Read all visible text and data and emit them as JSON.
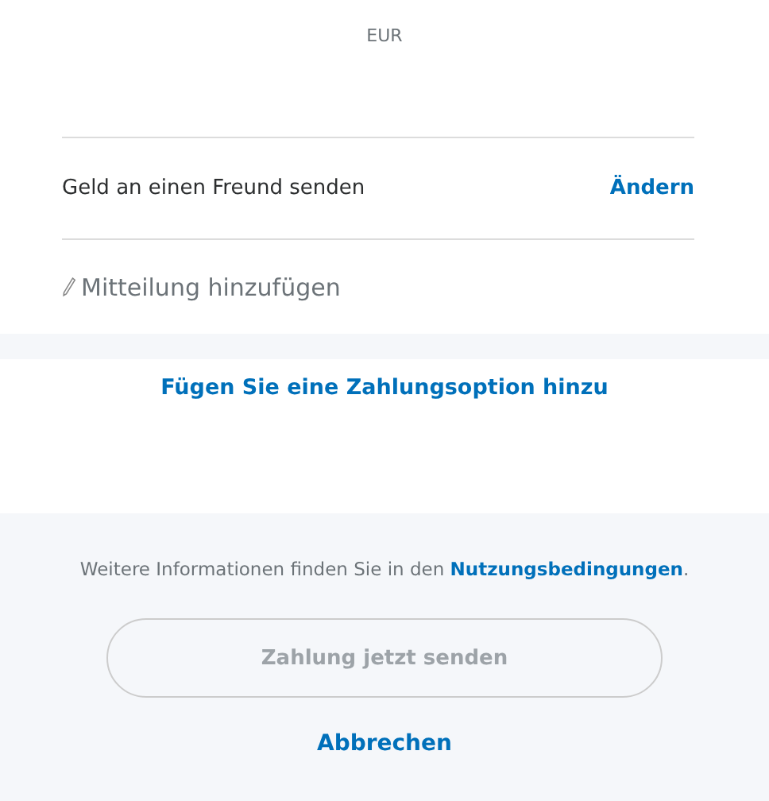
{
  "currency": "EUR",
  "recipient": {
    "label": "Geld an einen Freund senden",
    "action": "Ändern"
  },
  "message": {
    "placeholder": "Mitteilung hinzufügen"
  },
  "payment_option_link": "Fügen Sie eine Zahlungsoption hinzu",
  "terms": {
    "text": "Weitere Informationen finden Sie in den ",
    "link": "Nutzungsbedingungen",
    "after": "."
  },
  "send_button": {
    "label": "Zahlung jetzt senden",
    "disabled": true
  },
  "cancel_link": "Abbrechen"
}
